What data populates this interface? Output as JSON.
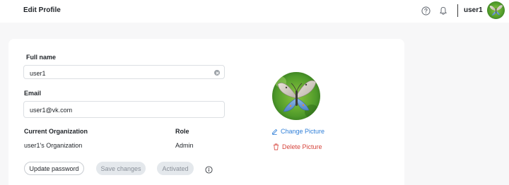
{
  "header": {
    "title": "Edit Profile",
    "help_icon": "help-circle-icon",
    "bell_icon": "bell-icon",
    "username": "user1"
  },
  "form": {
    "full_name": {
      "label": "Full name",
      "value": "user1"
    },
    "email": {
      "label": "Email",
      "value": "user1@vk.com"
    },
    "organization": {
      "label": "Current Organization",
      "value": "user1's Organization"
    },
    "role": {
      "label": "Role",
      "value": "Admin"
    }
  },
  "actions": {
    "update_password": "Update password",
    "save_changes": "Save changes",
    "activated": "Activated",
    "info_icon": "info-icon"
  },
  "picture": {
    "change_label": "Change Picture",
    "delete_label": "Delete Picture"
  },
  "colors": {
    "accent_blue": "#2f7fd8",
    "danger_red": "#d6453d",
    "disabled_bg": "#e4e8ec"
  }
}
